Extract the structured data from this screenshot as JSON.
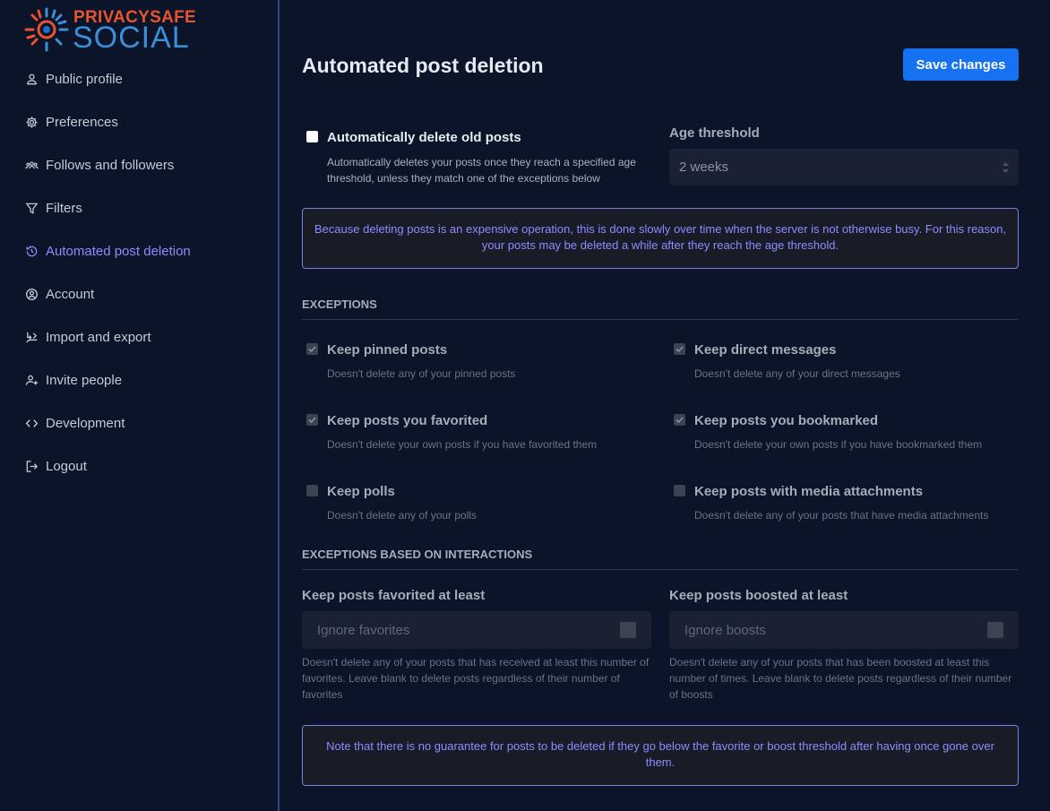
{
  "brand": {
    "top": "PRIVACYSAFE",
    "bottom": "SOCIAL",
    "top_color": "#e8542e",
    "bottom_color": "#3b8fd9"
  },
  "sidebar": {
    "items": [
      {
        "label": "Public profile",
        "icon": "user-icon"
      },
      {
        "label": "Preferences",
        "icon": "gear-icon"
      },
      {
        "label": "Follows and followers",
        "icon": "users-icon"
      },
      {
        "label": "Filters",
        "icon": "filter-icon"
      },
      {
        "label": "Automated post deletion",
        "icon": "history-icon",
        "active": true
      },
      {
        "label": "Account",
        "icon": "account-circle-icon"
      },
      {
        "label": "Import and export",
        "icon": "import-export-icon"
      },
      {
        "label": "Invite people",
        "icon": "user-plus-icon"
      },
      {
        "label": "Development",
        "icon": "code-icon"
      },
      {
        "label": "Logout",
        "icon": "logout-icon"
      }
    ]
  },
  "main": {
    "title": "Automated post deletion",
    "save_label": "Save changes",
    "auto_delete": {
      "label": "Automatically delete old posts",
      "hint": "Automatically deletes your posts once they reach a specified age threshold, unless they match one of the exceptions below",
      "checked": false
    },
    "age_threshold": {
      "label": "Age threshold",
      "value": "2 weeks"
    },
    "notice_top": "Because deleting posts is an expensive operation, this is done slowly over time when the server is not otherwise busy. For this reason, your posts may be deleted a while after they reach the age threshold.",
    "exceptions_heading": "EXCEPTIONS",
    "exceptions": [
      {
        "label": "Keep pinned posts",
        "hint": "Doesn't delete any of your pinned posts",
        "checked": true
      },
      {
        "label": "Keep direct messages",
        "hint": "Doesn't delete any of your direct messages",
        "checked": true
      },
      {
        "label": "Keep posts you favorited",
        "hint": "Doesn't delete your own posts if you have favorited them",
        "checked": true
      },
      {
        "label": "Keep posts you bookmarked",
        "hint": "Doesn't delete your own posts if you have bookmarked them",
        "checked": true
      },
      {
        "label": "Keep polls",
        "hint": "Doesn't delete any of your polls",
        "checked": false
      },
      {
        "label": "Keep posts with media attachments",
        "hint": "Doesn't delete any of your posts that have media attachments",
        "checked": false
      }
    ],
    "interactions_heading": "EXCEPTIONS BASED ON INTERACTIONS",
    "favorites": {
      "label": "Keep posts favorited at least",
      "placeholder": "Ignore favorites",
      "hint": "Doesn't delete any of your posts that has received at least this number of favorites. Leave blank to delete posts regardless of their number of favorites"
    },
    "boosts": {
      "label": "Keep posts boosted at least",
      "placeholder": "Ignore boosts",
      "hint": "Doesn't delete any of your posts that has been boosted at least this number of times. Leave blank to delete posts regardless of their number of boosts"
    },
    "notice_bottom": "Note that there is no guarantee for posts to be deleted if they go below the favorite or boost threshold after having once gone over them."
  }
}
